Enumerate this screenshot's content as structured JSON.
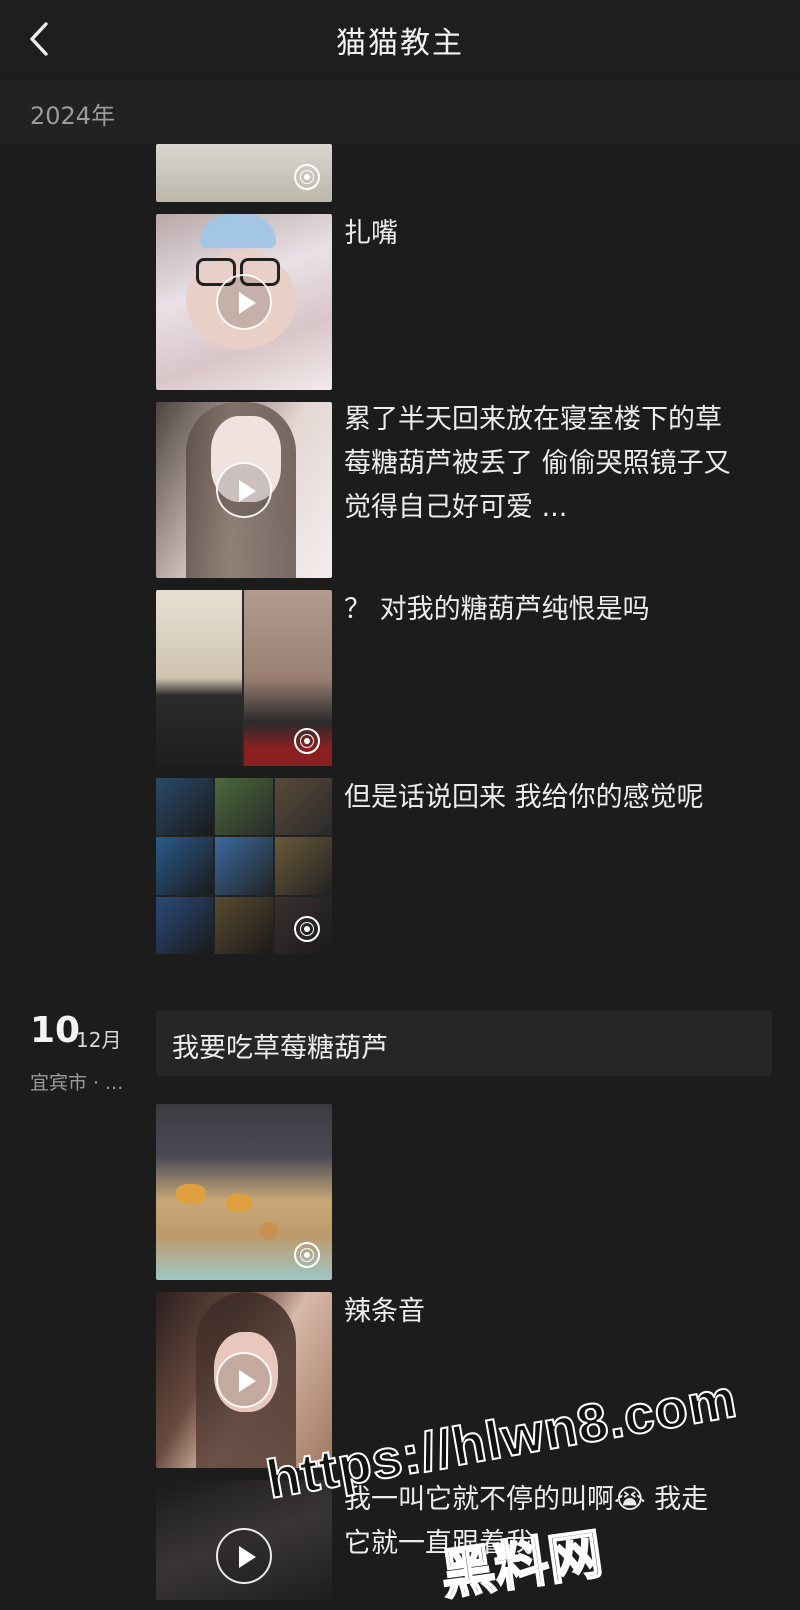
{
  "header": {
    "title": "猫猫教主"
  },
  "year_label": "2024年",
  "posts_top": [
    {
      "caption": ""
    },
    {
      "caption": "扎嘴"
    },
    {
      "caption": "累了半天回来放在寝室楼下的草莓糖葫芦被丢了 偷偷哭照镜子又觉得自己好可爱 ..."
    },
    {
      "caption": "？ 对我的糖葫芦纯恨是吗"
    },
    {
      "caption": "但是话说回来 我给你的感觉呢"
    }
  ],
  "date_group": {
    "day": "10",
    "month": "12月",
    "location": "宜宾市 · ...",
    "text_post": "我要吃草莓糖葫芦"
  },
  "posts_bottom": [
    {
      "caption": ""
    },
    {
      "caption": "辣条音"
    },
    {
      "caption": "我一叫它就不停的叫啊😭 我走它就一直跟着我"
    }
  ],
  "icons": {
    "back": "chevron-left-icon",
    "play": "play-icon",
    "live": "live-photo-icon"
  },
  "watermark": {
    "url": "https://hlwn8.com",
    "name": "黑料网"
  },
  "colors": {
    "background": "#1c1c1c",
    "header": "#1e1e1e",
    "text": "#ececec",
    "muted": "#9b9b9b"
  }
}
